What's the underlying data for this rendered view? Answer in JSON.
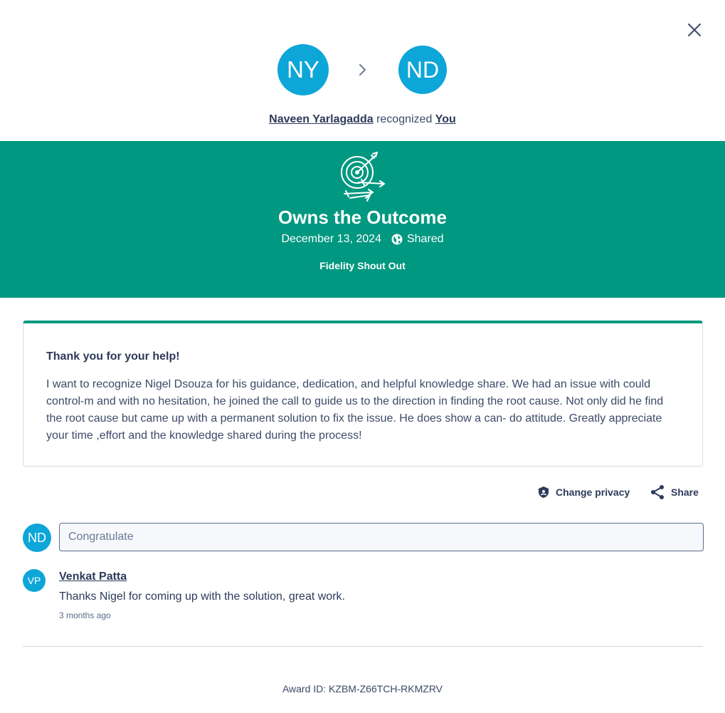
{
  "header": {
    "from_initials": "NY",
    "to_initials": "ND",
    "giver_name": "Naveen Yarlagadda",
    "verb": "recognized",
    "receiver_name": "You",
    "close_icon": "close-icon",
    "arrow_icon": "chevron-right-icon"
  },
  "award": {
    "icon": "target-arrows-icon",
    "title": "Owns the Outcome",
    "date": "December 13, 2024",
    "visibility": "Shared",
    "visibility_icon": "globe-icon",
    "program": "Fidelity Shout Out",
    "banner_color": "#009880"
  },
  "message": {
    "title": "Thank you for your help!",
    "body": "I want to recognize Nigel Dsouza for his guidance, dedication, and helpful knowledge share. We had an issue with could control-m and with no hesitation, he joined the call to guide us to the direction in finding the root cause. Not only did he find the root cause but came up with a permanent solution to fix the issue. He does show a can- do attitude. Greatly appreciate your time ,effort and the knowledge shared during the process!"
  },
  "actions": {
    "privacy_label": "Change privacy",
    "privacy_icon": "shield-icon",
    "share_label": "Share",
    "share_icon": "share-icon"
  },
  "comment_box": {
    "avatar_initials": "ND",
    "placeholder": "Congratulate",
    "value": ""
  },
  "comments": [
    {
      "initials": "VP",
      "name": "Venkat Patta",
      "text": "Thanks Nigel for coming up with the solution, great work.",
      "time": "3 months ago"
    }
  ],
  "footer": {
    "award_id": "Award ID: KZBM-Z66TCH-RKMZRV"
  },
  "colors": {
    "accent": "#009880",
    "avatar": "#0da6d8",
    "text": "#2d3a5a"
  }
}
